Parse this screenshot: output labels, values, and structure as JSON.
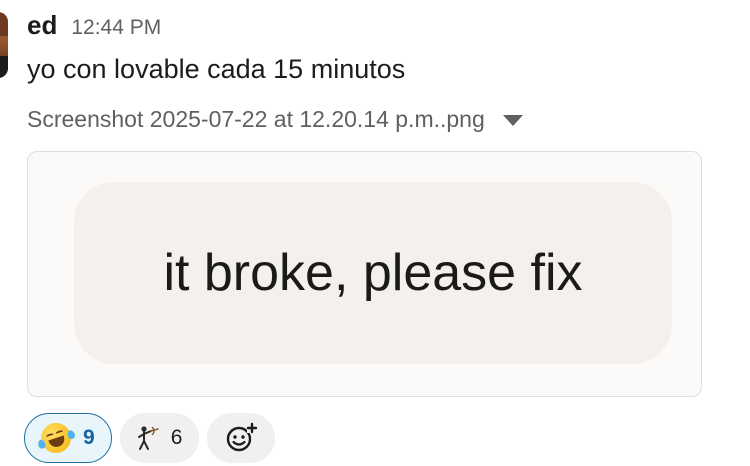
{
  "message": {
    "author": "ed",
    "timestamp": "12:44 PM",
    "text": "yo con lovable cada 15 minutos"
  },
  "attachment": {
    "file_name": "Screenshot 2025-07-22 at 12.20.14 p.m..png",
    "caret_icon": "caret-down-icon",
    "image_text": "it broke, please fix"
  },
  "reactions": [
    {
      "emoji_icon": "rolling-on-floor-laughing-icon",
      "count": "9",
      "selected": true
    },
    {
      "emoji_icon": "archer-figure-icon",
      "count": "6",
      "selected": false
    }
  ],
  "add_reaction_icon": "add-reaction-icon",
  "colors": {
    "selected_reaction_border": "#1d6fa3",
    "selected_reaction_bg": "#e8f5fa",
    "muted_text": "#616061"
  }
}
